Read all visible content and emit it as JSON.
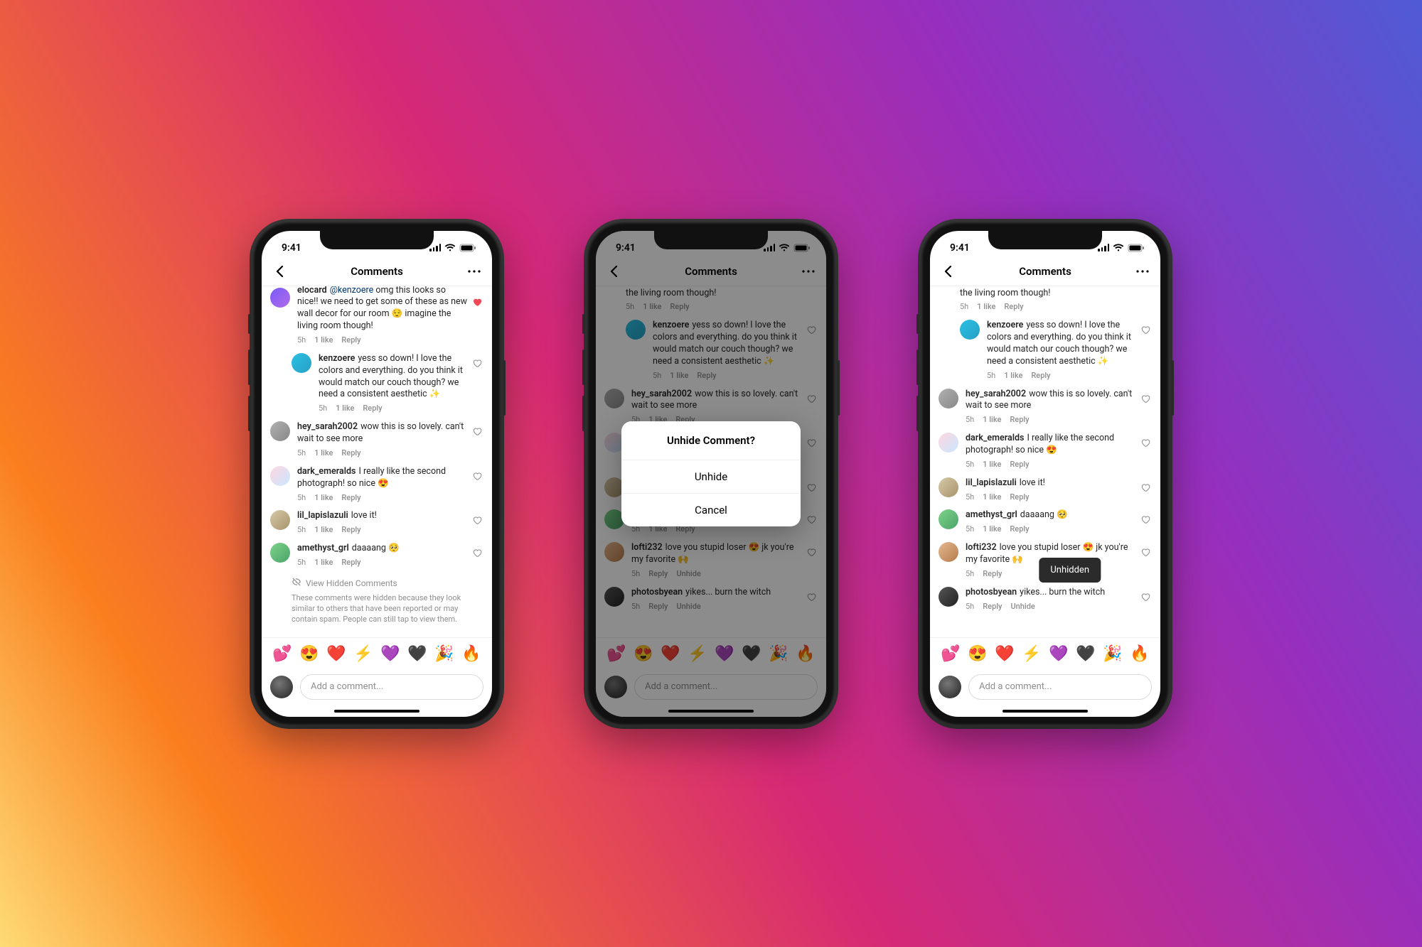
{
  "status": {
    "time": "9:41"
  },
  "header": {
    "title": "Comments"
  },
  "emojis": [
    "💕",
    "😍",
    "❤️",
    "⚡",
    "💜",
    "🖤",
    "🎉",
    "🔥"
  ],
  "composer": {
    "placeholder": "Add a comment..."
  },
  "dialog": {
    "title": "Unhide Comment?",
    "unhide": "Unhide",
    "cancel": "Cancel"
  },
  "toast": {
    "label": "Unhidden"
  },
  "hidden": {
    "title": "View Hidden Comments",
    "desc": "These comments were hidden because they look similar to others that have been reported or may contain spam. People can still tap to view them."
  },
  "labels": {
    "reply": "Reply",
    "unhide": "Unhide"
  },
  "top_partial": {
    "text_a": "we need to get some of these as new wall decor for our room 😌 imagine the living room though!",
    "tail": "the living room though!",
    "time": "5h",
    "likes": "1 like"
  },
  "c": {
    "kenzoere": {
      "user": "kenzoere",
      "text": "yess so down! I love the colors and everything. do you think it would match our couch though? we need a consistent aesthetic ✨",
      "time": "5h",
      "likes": "1 like"
    },
    "sarah": {
      "user": "hey_sarah2002",
      "text": "wow this is so lovely. can't wait to see more",
      "time": "5h",
      "likes": "1 like"
    },
    "dark": {
      "user": "dark_emeralds",
      "text": "I really like the second photograph! so nice 😍",
      "time": "5h",
      "likes": "1 like"
    },
    "lapis": {
      "user": "lil_lapislazuli",
      "text": "love it!",
      "time": "5h",
      "likes": "1 like"
    },
    "amethyst": {
      "user": "amethyst_grl",
      "text": "daaaang 🥺",
      "time": "5h",
      "likes": "1 like"
    },
    "lofti": {
      "user": "lofti232",
      "text": "love you stupid loser 😍 jk you're my favorite 🙌",
      "time": "5h"
    },
    "photos": {
      "user": "photosbyean",
      "text": "yikes... burn the witch",
      "time": "5h"
    }
  },
  "mention": {
    "user": "elocard",
    "at": "@kenzoere",
    "lead": "omg this looks so nice!! "
  }
}
